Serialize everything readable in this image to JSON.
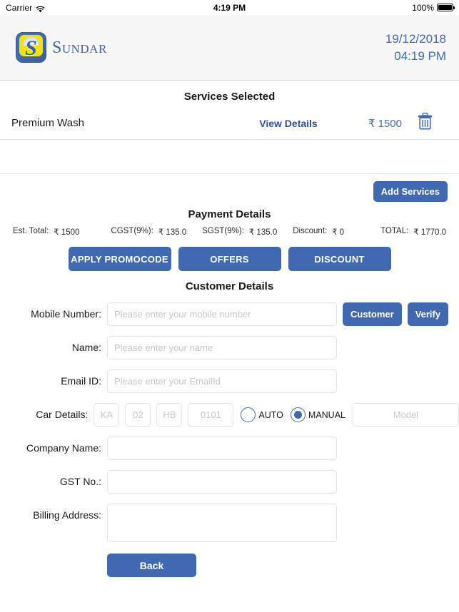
{
  "statusbar": {
    "carrier": "Carrier",
    "wifi_icon": "wifi-icon",
    "time": "4:19 PM",
    "battery_percent": "100%",
    "battery_icon": "battery-full-icon"
  },
  "header": {
    "logo_letter": "S",
    "brand_name": "Sundar",
    "date": "19/12/2018",
    "time": "04:19 PM",
    "accent_color": "#3f6ab5"
  },
  "services": {
    "title": "Services Selected",
    "items": [
      {
        "name": "Premium Wash",
        "view_details": "View Details",
        "price": "₹ 1500",
        "delete_icon": "trash-icon"
      }
    ],
    "add_services_label": "Add Services"
  },
  "payment": {
    "title": "Payment Details",
    "fields": [
      {
        "label": "Est. Total:",
        "value": "₹ 1500"
      },
      {
        "label": "CGST(9%):",
        "value": "₹ 135.0"
      },
      {
        "label": "SGST(9%):",
        "value": "₹ 135.0"
      },
      {
        "label": "Discount:",
        "value": "₹ 0"
      }
    ],
    "total_label": "TOTAL:",
    "total_value": "₹ 1770.0",
    "buttons": [
      {
        "label": "APPLY PROMOCODE"
      },
      {
        "label": "OFFERS"
      },
      {
        "label": "DISCOUNT"
      }
    ]
  },
  "customer": {
    "title": "Customer Details",
    "mobile": {
      "label": "Mobile Number:",
      "value": "",
      "placeholder": "Please enter your mobile number",
      "customer_button": "Customer",
      "verify_button": "Verify"
    },
    "name": {
      "label": "Name:",
      "value": "",
      "placeholder": "Please enter your name"
    },
    "email": {
      "label": "Email ID:",
      "value": "",
      "placeholder": "Please enter your EmailId"
    },
    "car": {
      "label": "Car Details:",
      "state": {
        "value": "",
        "placeholder": "KA"
      },
      "district": {
        "value": "",
        "placeholder": "02"
      },
      "series": {
        "value": "",
        "placeholder": "HB"
      },
      "number": {
        "value": "",
        "placeholder": "0101"
      },
      "transmission_options": [
        {
          "label": "AUTO",
          "selected": false
        },
        {
          "label": "MANUAL",
          "selected": true
        }
      ],
      "model": {
        "value": "",
        "placeholder": "Model"
      }
    },
    "company": {
      "label": "Company Name:",
      "value": "",
      "placeholder": ""
    },
    "gst": {
      "label": "GST No.:",
      "value": "",
      "placeholder": ""
    },
    "billing": {
      "label": "Billing Address:",
      "value": "",
      "placeholder": ""
    },
    "back_button": "Back"
  },
  "theme": {
    "primary_blue": "#4169b2",
    "link_blue": "#2d4fa0",
    "header_bg": "#f7f7f7",
    "border_grey": "#e2e2e2"
  }
}
